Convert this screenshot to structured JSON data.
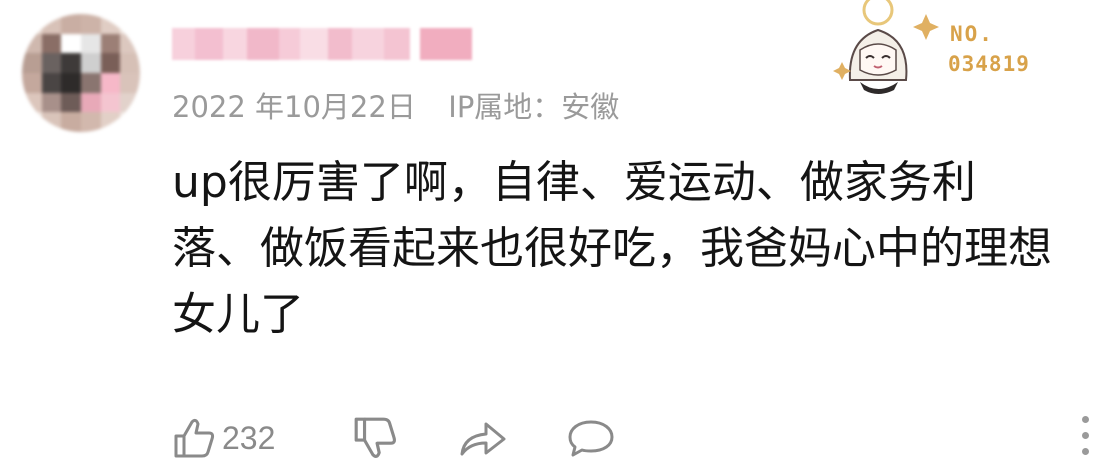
{
  "comment": {
    "date": "2022 年10月22日",
    "ip_location": "IP属地：安徽",
    "text": "up很厉害了啊，自律、爱运动、做家务利落、做饭看起来也很好吃，我爸妈心中的理想女儿了",
    "badge": {
      "label": "NO.",
      "number": "034819"
    },
    "likes": "232"
  },
  "icons": {
    "like": "thumbs-up-icon",
    "dislike": "thumbs-down-icon",
    "share": "share-icon",
    "reply": "comment-icon",
    "more": "more-vertical-icon"
  },
  "colors": {
    "badge_gold": "#d8a24a",
    "meta_gray": "#9a9a9a",
    "text": "#141414",
    "username_pink": "#f2b6c8"
  }
}
